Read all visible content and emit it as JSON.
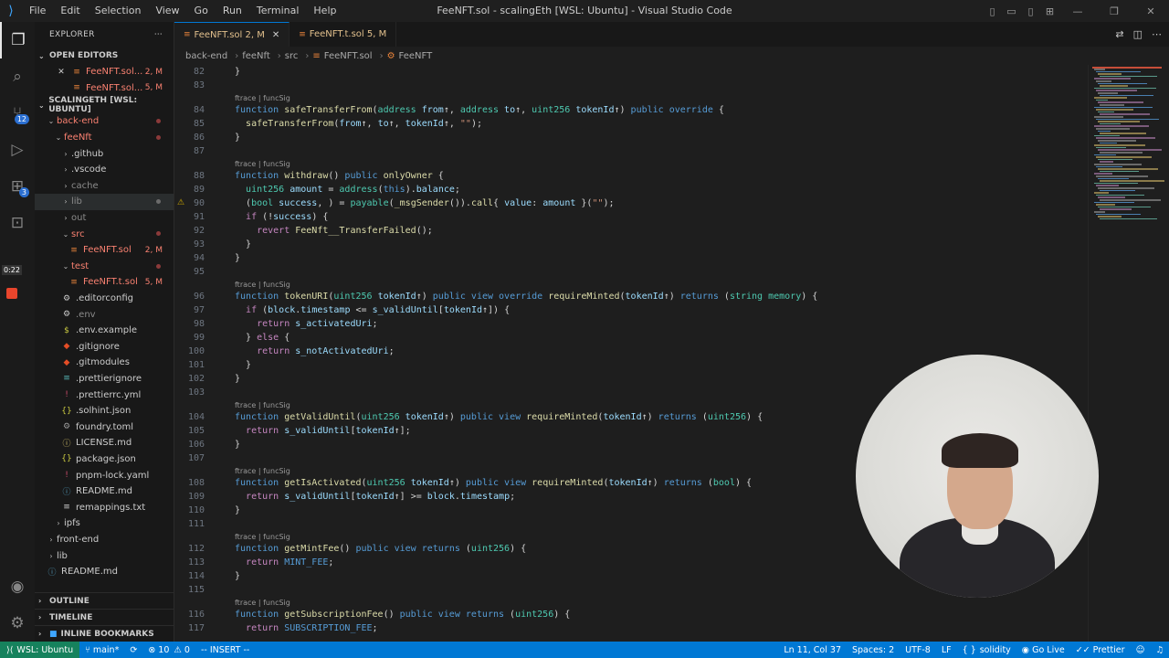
{
  "window": {
    "title": "FeeNFT.sol - scalingEth [WSL: Ubuntu] - Visual Studio Code",
    "menu": [
      "File",
      "Edit",
      "Selection",
      "View",
      "Go",
      "Run",
      "Terminal",
      "Help"
    ]
  },
  "activity_bar": {
    "scm_badge": "12",
    "ext_badge": "3",
    "timer": "0:22"
  },
  "sidebar": {
    "title": "EXPLORER",
    "open_editors_label": "OPEN EDITORS",
    "open_editors": [
      {
        "name": "FeeNFT.sol...",
        "status": "2, M",
        "close": "✕"
      },
      {
        "name": "FeeNFT.sol...",
        "status": "5, M"
      }
    ],
    "workspace_label": "SCALINGETH [WSL: UBUNTU]",
    "tree": [
      {
        "name": "back-end",
        "indent": 1,
        "chev": "⌄",
        "kind": "folder",
        "color": "#f88070",
        "dot": true
      },
      {
        "name": "feeNft",
        "indent": 2,
        "chev": "⌄",
        "kind": "folder",
        "color": "#f88070",
        "dot": true
      },
      {
        "name": ".github",
        "indent": 3,
        "chev": "›",
        "kind": "folder",
        "color": "#cccccc"
      },
      {
        "name": ".vscode",
        "indent": 3,
        "chev": "›",
        "kind": "folder",
        "color": "#cccccc"
      },
      {
        "name": "cache",
        "indent": 3,
        "chev": "›",
        "kind": "folder",
        "color": "#8b8b8b"
      },
      {
        "name": "lib",
        "indent": 3,
        "chev": "›",
        "kind": "folder",
        "color": "#8b8b8b",
        "selected": true,
        "dot": true,
        "dotColor": "#6b6b6b"
      },
      {
        "name": "out",
        "indent": 3,
        "chev": "›",
        "kind": "folder",
        "color": "#8b8b8b"
      },
      {
        "name": "src",
        "indent": 3,
        "chev": "⌄",
        "kind": "folder",
        "color": "#f88070",
        "dot": true
      },
      {
        "name": "FeeNFT.sol",
        "indent": 4,
        "icon": "≡",
        "iconColor": "#e8833a",
        "kind": "file",
        "color": "#f88070",
        "status": "2, M"
      },
      {
        "name": "test",
        "indent": 3,
        "chev": "⌄",
        "kind": "folder",
        "color": "#f88070",
        "dot": true
      },
      {
        "name": "FeeNFT.t.sol",
        "indent": 4,
        "icon": "≡",
        "iconColor": "#e8833a",
        "kind": "file",
        "color": "#f88070",
        "status": "5, M"
      },
      {
        "name": ".editorconfig",
        "indent": 3,
        "icon": "⚙",
        "iconColor": "#cccccc",
        "kind": "file",
        "color": "#cccccc"
      },
      {
        "name": ".env",
        "indent": 3,
        "icon": "⚙",
        "iconColor": "#cccccc",
        "kind": "file",
        "color": "#8b8b8b"
      },
      {
        "name": ".env.example",
        "indent": 3,
        "icon": "$",
        "iconColor": "#cbcb41",
        "kind": "file",
        "color": "#cccccc"
      },
      {
        "name": ".gitignore",
        "indent": 3,
        "icon": "◆",
        "iconColor": "#e44d26",
        "kind": "file",
        "color": "#cccccc"
      },
      {
        "name": ".gitmodules",
        "indent": 3,
        "icon": "◆",
        "iconColor": "#e44d26",
        "kind": "file",
        "color": "#cccccc"
      },
      {
        "name": ".prettierignore",
        "indent": 3,
        "icon": "≡",
        "iconColor": "#56b3b4",
        "kind": "file",
        "color": "#cccccc"
      },
      {
        "name": ".prettierrc.yml",
        "indent": 3,
        "icon": "!",
        "iconColor": "#cb4b6a",
        "kind": "file",
        "color": "#cccccc"
      },
      {
        "name": ".solhint.json",
        "indent": 3,
        "icon": "{}",
        "iconColor": "#cbcb41",
        "kind": "file",
        "color": "#cccccc"
      },
      {
        "name": "foundry.toml",
        "indent": 3,
        "icon": "⚙",
        "iconColor": "#9c9c9c",
        "kind": "file",
        "color": "#cccccc"
      },
      {
        "name": "LICENSE.md",
        "indent": 3,
        "icon": "ⓘ",
        "iconColor": "#d4c16a",
        "kind": "file",
        "color": "#cccccc"
      },
      {
        "name": "package.json",
        "indent": 3,
        "icon": "{}",
        "iconColor": "#cbcb41",
        "kind": "file",
        "color": "#cccccc"
      },
      {
        "name": "pnpm-lock.yaml",
        "indent": 3,
        "icon": "!",
        "iconColor": "#cb4b6a",
        "kind": "file",
        "color": "#cccccc"
      },
      {
        "name": "README.md",
        "indent": 3,
        "icon": "ⓘ",
        "iconColor": "#519aba",
        "kind": "file",
        "color": "#cccccc"
      },
      {
        "name": "remappings.txt",
        "indent": 3,
        "icon": "≡",
        "iconColor": "#cccccc",
        "kind": "file",
        "color": "#cccccc"
      },
      {
        "name": "ipfs",
        "indent": 2,
        "chev": "›",
        "kind": "folder",
        "color": "#cccccc"
      },
      {
        "name": "front-end",
        "indent": 1,
        "chev": "›",
        "kind": "folder",
        "color": "#cccccc"
      },
      {
        "name": "lib",
        "indent": 1,
        "chev": "›",
        "kind": "folder",
        "color": "#cccccc"
      },
      {
        "name": "README.md",
        "indent": 1,
        "icon": "ⓘ",
        "iconColor": "#519aba",
        "kind": "file",
        "color": "#cccccc"
      }
    ],
    "bottom_sections": [
      "OUTLINE",
      "TIMELINE",
      "INLINE BOOKMARKS"
    ]
  },
  "tabs": [
    {
      "label": "FeeNFT.sol 2, M",
      "active": true,
      "close": "✕"
    },
    {
      "label": "FeeNFT.t.sol 5, M",
      "active": false
    }
  ],
  "breadcrumb": [
    "back-end",
    "feeNft",
    "src",
    "FeeNFT.sol",
    "FeeNFT"
  ],
  "code": [
    {
      "n": "82",
      "tokens": [
        [
          "}",
          "p"
        ]
      ]
    },
    {
      "n": "83",
      "tokens": []
    },
    {
      "lens": "ftrace | funcSig"
    },
    {
      "n": "84",
      "tokens": [
        [
          "function ",
          "kb"
        ],
        [
          "safeTransferFrom",
          "f"
        ],
        [
          "(",
          "p"
        ],
        [
          "address ",
          "t"
        ],
        [
          "from",
          "v"
        ],
        [
          "↑, ",
          "p"
        ],
        [
          "address ",
          "t"
        ],
        [
          "to",
          "v"
        ],
        [
          "↑, ",
          "p"
        ],
        [
          "uint256 ",
          "t"
        ],
        [
          "tokenId",
          "v"
        ],
        [
          "↑) ",
          "p"
        ],
        [
          "public override",
          "kb"
        ],
        [
          " {",
          "p"
        ]
      ]
    },
    {
      "n": "85",
      "tokens": [
        [
          "  ",
          "p"
        ],
        [
          "safeTransferFrom",
          "f"
        ],
        [
          "(",
          "p"
        ],
        [
          "from",
          "v"
        ],
        [
          "↑, ",
          "p"
        ],
        [
          "to",
          "v"
        ],
        [
          "↑, ",
          "p"
        ],
        [
          "tokenId",
          "v"
        ],
        [
          "↑, ",
          "p"
        ],
        [
          "\"\"",
          "s"
        ],
        [
          ");",
          "p"
        ]
      ]
    },
    {
      "n": "86",
      "tokens": [
        [
          "}",
          "p"
        ]
      ]
    },
    {
      "n": "87",
      "tokens": []
    },
    {
      "lens": "ftrace | funcSig"
    },
    {
      "n": "88",
      "tokens": [
        [
          "function ",
          "kb"
        ],
        [
          "withdraw",
          "f"
        ],
        [
          "() ",
          "p"
        ],
        [
          "public ",
          "kb"
        ],
        [
          "onlyOwner",
          "f"
        ],
        [
          " {",
          "p"
        ]
      ]
    },
    {
      "n": "89",
      "tokens": [
        [
          "  ",
          "p"
        ],
        [
          "uint256 ",
          "t"
        ],
        [
          "amount",
          "v"
        ],
        [
          " = ",
          "p"
        ],
        [
          "address",
          "t"
        ],
        [
          "(",
          "p"
        ],
        [
          "this",
          "kb"
        ],
        [
          ").",
          "p"
        ],
        [
          "balance",
          "v"
        ],
        [
          ";",
          "p"
        ]
      ]
    },
    {
      "n": "90",
      "warn": true,
      "tokens": [
        [
          "  (",
          "p"
        ],
        [
          "bool ",
          "t"
        ],
        [
          "success",
          "v"
        ],
        [
          ", ) = ",
          "p"
        ],
        [
          "payable",
          "t"
        ],
        [
          "(",
          "p"
        ],
        [
          "_msgSender",
          "f"
        ],
        [
          "()).",
          "p"
        ],
        [
          "call",
          "f"
        ],
        [
          "{ ",
          "p"
        ],
        [
          "value",
          "v"
        ],
        [
          ": ",
          "p"
        ],
        [
          "amount",
          "v"
        ],
        [
          " }(",
          "p"
        ],
        [
          "\"\"",
          "s"
        ],
        [
          ");",
          "p"
        ]
      ]
    },
    {
      "n": "91",
      "tokens": [
        [
          "  ",
          "p"
        ],
        [
          "if",
          "k"
        ],
        [
          " (!",
          "p"
        ],
        [
          "success",
          "v"
        ],
        [
          ") {",
          "p"
        ]
      ]
    },
    {
      "n": "92",
      "tokens": [
        [
          "    ",
          "p"
        ],
        [
          "revert ",
          "k"
        ],
        [
          "FeeNft__TransferFailed",
          "f"
        ],
        [
          "();",
          "p"
        ]
      ]
    },
    {
      "n": "93",
      "tokens": [
        [
          "  }",
          "p"
        ]
      ]
    },
    {
      "n": "94",
      "tokens": [
        [
          "}",
          "p"
        ]
      ]
    },
    {
      "n": "95",
      "tokens": []
    },
    {
      "lens": "ftrace | funcSig"
    },
    {
      "n": "96",
      "tokens": [
        [
          "function ",
          "kb"
        ],
        [
          "tokenURI",
          "f"
        ],
        [
          "(",
          "p"
        ],
        [
          "uint256 ",
          "t"
        ],
        [
          "tokenId",
          "v"
        ],
        [
          "↑) ",
          "p"
        ],
        [
          "public view override ",
          "kb"
        ],
        [
          "requireMinted",
          "f"
        ],
        [
          "(",
          "p"
        ],
        [
          "tokenId",
          "v"
        ],
        [
          "↑) ",
          "p"
        ],
        [
          "returns ",
          "kb"
        ],
        [
          "(",
          "p"
        ],
        [
          "string memory",
          "t"
        ],
        [
          ") {",
          "p"
        ]
      ]
    },
    {
      "n": "97",
      "tokens": [
        [
          "  ",
          "p"
        ],
        [
          "if",
          "k"
        ],
        [
          " (",
          "p"
        ],
        [
          "block",
          "v"
        ],
        [
          ".",
          "p"
        ],
        [
          "timestamp",
          "v"
        ],
        [
          " <= ",
          "p"
        ],
        [
          "s_validUntil",
          "v"
        ],
        [
          "[",
          "p"
        ],
        [
          "tokenId",
          "v"
        ],
        [
          "↑]) {",
          "p"
        ]
      ]
    },
    {
      "n": "98",
      "tokens": [
        [
          "    ",
          "p"
        ],
        [
          "return ",
          "k"
        ],
        [
          "s_activatedUri",
          "v"
        ],
        [
          ";",
          "p"
        ]
      ]
    },
    {
      "n": "99",
      "tokens": [
        [
          "  } ",
          "p"
        ],
        [
          "else",
          "k"
        ],
        [
          " {",
          "p"
        ]
      ]
    },
    {
      "n": "100",
      "tokens": [
        [
          "    ",
          "p"
        ],
        [
          "return ",
          "k"
        ],
        [
          "s_notActivatedUri",
          "v"
        ],
        [
          ";",
          "p"
        ]
      ]
    },
    {
      "n": "101",
      "tokens": [
        [
          "  }",
          "p"
        ]
      ]
    },
    {
      "n": "102",
      "tokens": [
        [
          "}",
          "p"
        ]
      ]
    },
    {
      "n": "103",
      "tokens": []
    },
    {
      "lens": "ftrace | funcSig"
    },
    {
      "n": "104",
      "tokens": [
        [
          "function ",
          "kb"
        ],
        [
          "getValidUntil",
          "f"
        ],
        [
          "(",
          "p"
        ],
        [
          "uint256 ",
          "t"
        ],
        [
          "tokenId",
          "v"
        ],
        [
          "↑) ",
          "p"
        ],
        [
          "public view ",
          "kb"
        ],
        [
          "requireMinted",
          "f"
        ],
        [
          "(",
          "p"
        ],
        [
          "tokenId",
          "v"
        ],
        [
          "↑) ",
          "p"
        ],
        [
          "returns ",
          "kb"
        ],
        [
          "(",
          "p"
        ],
        [
          "uint256",
          "t"
        ],
        [
          ") {",
          "p"
        ]
      ]
    },
    {
      "n": "105",
      "tokens": [
        [
          "  ",
          "p"
        ],
        [
          "return ",
          "k"
        ],
        [
          "s_validUntil",
          "v"
        ],
        [
          "[",
          "p"
        ],
        [
          "tokenId",
          "v"
        ],
        [
          "↑];",
          "p"
        ]
      ]
    },
    {
      "n": "106",
      "tokens": [
        [
          "}",
          "p"
        ]
      ]
    },
    {
      "n": "107",
      "tokens": []
    },
    {
      "lens": "ftrace | funcSig"
    },
    {
      "n": "108",
      "tokens": [
        [
          "function ",
          "kb"
        ],
        [
          "getIsActivated",
          "f"
        ],
        [
          "(",
          "p"
        ],
        [
          "uint256 ",
          "t"
        ],
        [
          "tokenId",
          "v"
        ],
        [
          "↑) ",
          "p"
        ],
        [
          "public view ",
          "kb"
        ],
        [
          "requireMinted",
          "f"
        ],
        [
          "(",
          "p"
        ],
        [
          "tokenId",
          "v"
        ],
        [
          "↑) ",
          "p"
        ],
        [
          "returns ",
          "kb"
        ],
        [
          "(",
          "p"
        ],
        [
          "bool",
          "t"
        ],
        [
          ") {",
          "p"
        ]
      ]
    },
    {
      "n": "109",
      "tokens": [
        [
          "  ",
          "p"
        ],
        [
          "return ",
          "k"
        ],
        [
          "s_validUntil",
          "v"
        ],
        [
          "[",
          "p"
        ],
        [
          "tokenId",
          "v"
        ],
        [
          "↑] >= ",
          "p"
        ],
        [
          "block",
          "v"
        ],
        [
          ".",
          "p"
        ],
        [
          "timestamp",
          "v"
        ],
        [
          ";",
          "p"
        ]
      ]
    },
    {
      "n": "110",
      "tokens": [
        [
          "}",
          "p"
        ]
      ]
    },
    {
      "n": "111",
      "tokens": []
    },
    {
      "lens": "ftrace | funcSig"
    },
    {
      "n": "112",
      "tokens": [
        [
          "function ",
          "kb"
        ],
        [
          "getMintFee",
          "f"
        ],
        [
          "() ",
          "p"
        ],
        [
          "public view returns ",
          "kb"
        ],
        [
          "(",
          "p"
        ],
        [
          "uint256",
          "t"
        ],
        [
          ") {",
          "p"
        ]
      ]
    },
    {
      "n": "113",
      "tokens": [
        [
          "  ",
          "p"
        ],
        [
          "return ",
          "k"
        ],
        [
          "MINT_FEE",
          "kb"
        ],
        [
          ";",
          "p"
        ]
      ]
    },
    {
      "n": "114",
      "tokens": [
        [
          "}",
          "p"
        ]
      ]
    },
    {
      "n": "115",
      "tokens": []
    },
    {
      "lens": "ftrace | funcSig"
    },
    {
      "n": "116",
      "tokens": [
        [
          "function ",
          "kb"
        ],
        [
          "getSubscriptionFee",
          "f"
        ],
        [
          "() ",
          "p"
        ],
        [
          "public view returns ",
          "kb"
        ],
        [
          "(",
          "p"
        ],
        [
          "uint256",
          "t"
        ],
        [
          ") {",
          "p"
        ]
      ]
    },
    {
      "n": "117",
      "tokens": [
        [
          "  ",
          "p"
        ],
        [
          "return ",
          "k"
        ],
        [
          "SUBSCRIPTION_FEE",
          "kb"
        ],
        [
          ";",
          "p"
        ]
      ]
    }
  ],
  "statusbar": {
    "remote": "WSL: Ubuntu",
    "branch": "main*",
    "errors": "10",
    "warnings": "0",
    "mode": "-- INSERT --",
    "position": "Ln 11, Col 37",
    "spaces": "Spaces: 2",
    "encoding": "UTF-8",
    "eol": "LF",
    "language": "solidity",
    "golive": "Go Live",
    "prettier": "Prettier"
  },
  "colors": {
    "accent": "#0078d4",
    "remote": "#16825d",
    "modified": "#e2c08d",
    "error": "#f88070"
  }
}
